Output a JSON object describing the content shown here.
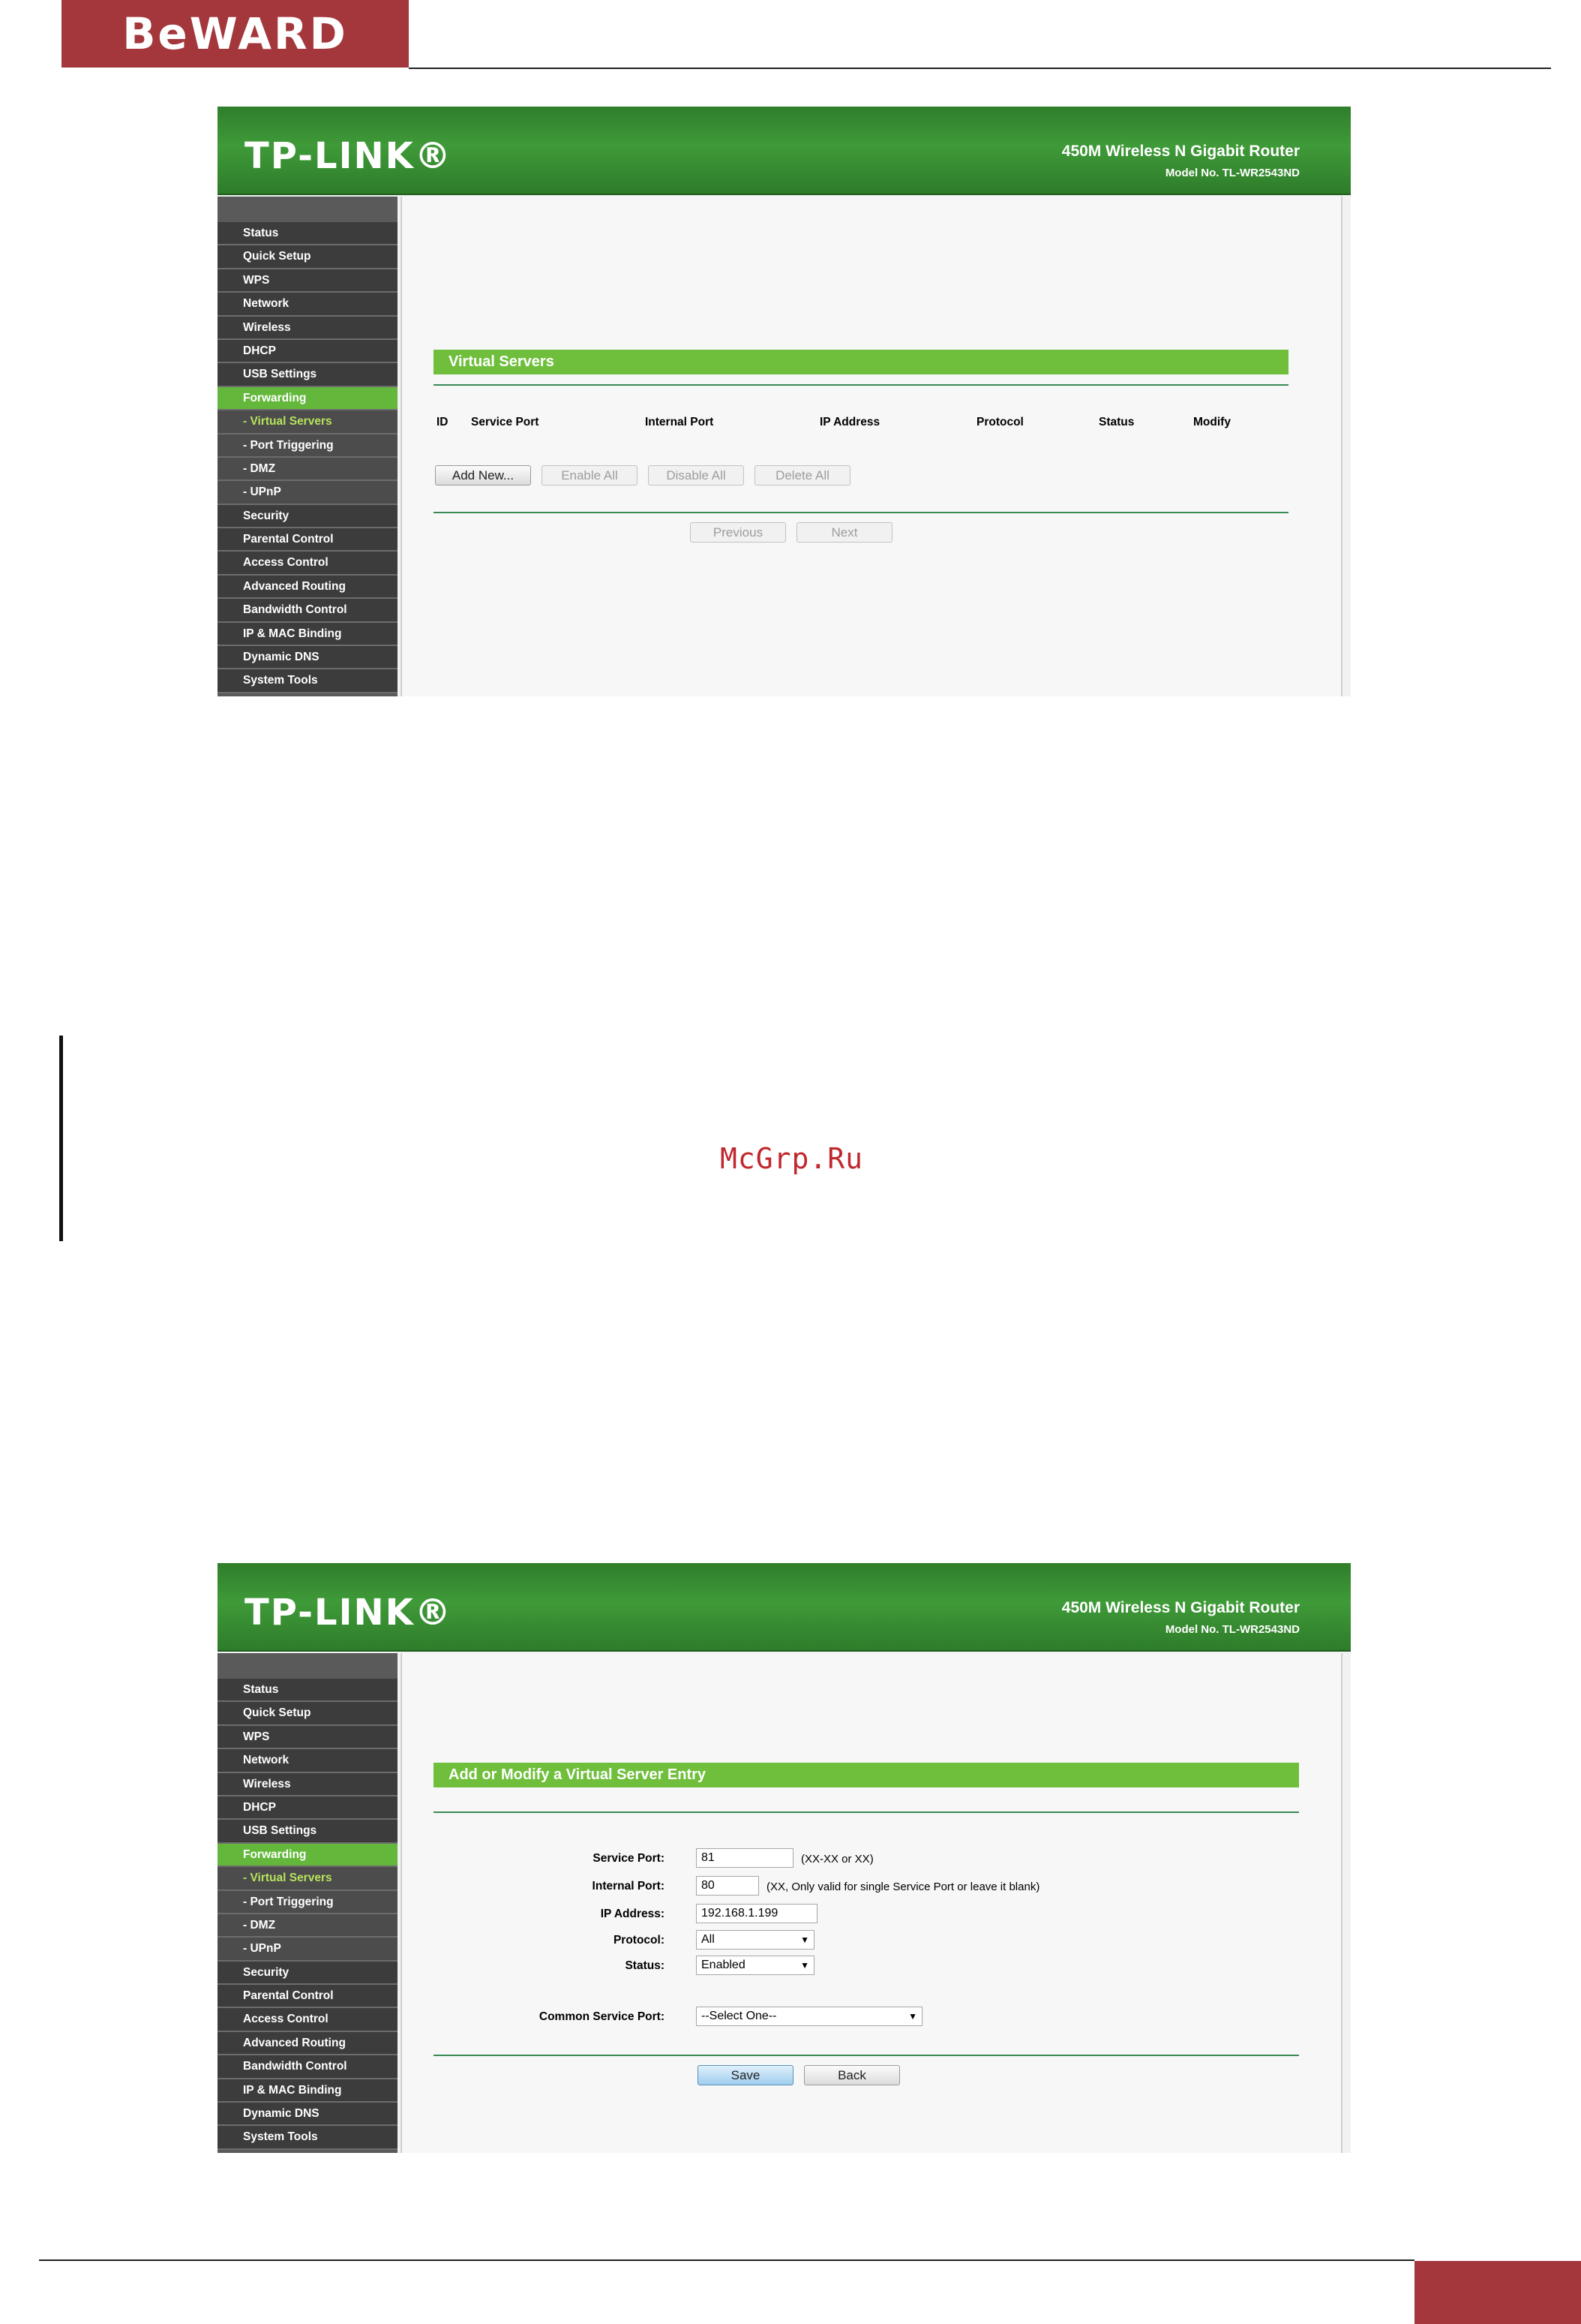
{
  "brand": {
    "logo": "BeWARD"
  },
  "watermark": "McGrp.Ru",
  "router": {
    "logo": "TP-LINK®",
    "product": "450M Wireless N Gigabit Router",
    "model": "Model No. TL-WR2543ND"
  },
  "sidebar": {
    "items": [
      "Status",
      "Quick Setup",
      "WPS",
      "Network",
      "Wireless",
      "DHCP",
      "USB Settings",
      "Forwarding",
      "- Virtual Servers",
      "- Port Triggering",
      "- DMZ",
      "- UPnP",
      "Security",
      "Parental Control",
      "Access Control",
      "Advanced Routing",
      "Bandwidth Control",
      "IP & MAC Binding",
      "Dynamic DNS",
      "System Tools"
    ]
  },
  "virtual_servers": {
    "title": "Virtual Servers",
    "columns": [
      "ID",
      "Service Port",
      "Internal Port",
      "IP Address",
      "Protocol",
      "Status",
      "Modify"
    ],
    "buttons": {
      "add_new": "Add New...",
      "enable_all": "Enable All",
      "disable_all": "Disable All",
      "delete_all": "Delete All"
    },
    "pager": {
      "previous": "Previous",
      "next": "Next"
    }
  },
  "entry_form": {
    "title": "Add or Modify a Virtual Server Entry",
    "service_port": {
      "label": "Service Port:",
      "value": "81",
      "hint": "(XX-XX or XX)"
    },
    "internal_port": {
      "label": "Internal Port:",
      "value": "80",
      "hint": "(XX, Only valid for single Service Port or leave it blank)"
    },
    "ip_address": {
      "label": "IP Address:",
      "value": "192.168.1.199"
    },
    "protocol": {
      "label": "Protocol:",
      "value": "All"
    },
    "status": {
      "label": "Status:",
      "value": "Enabled"
    },
    "common_service_port": {
      "label": "Common Service Port:",
      "value": "--Select One--"
    },
    "buttons": {
      "save": "Save",
      "back": "Back"
    }
  },
  "colors": {
    "brand_red": "#a3373c",
    "router_green": "#3f9a38",
    "accent_green": "#6fbf3c",
    "watermark": "#c0282d"
  }
}
